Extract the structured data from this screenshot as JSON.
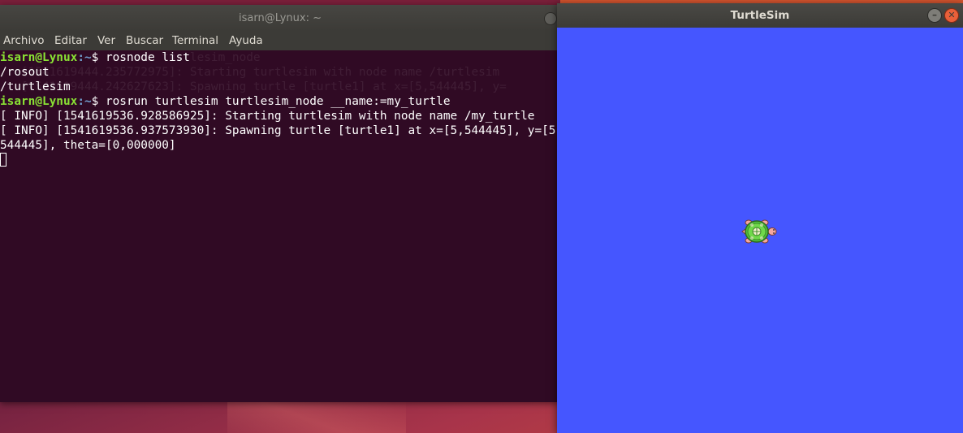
{
  "terminal": {
    "title": "isarn@Lynux: ~",
    "menu": [
      "Archivo",
      "Editar",
      "Ver",
      "Buscar",
      "Terminal",
      "Ayuda"
    ],
    "ghost_lines": [
      "                   sim turtlesim_node",
      "   [1541619444.235772975]: Starting turtlesim with node name /turtlesim",
      "   [1541619444.242627623]: Spawning turtle [turtle1] at x=[5,544445], y="
    ],
    "prompt_user": "isarn@Lynux",
    "prompt_path": ":~",
    "prompt_symbol": "$",
    "cmd1": " rosnode list",
    "out1": "/rosout",
    "out2": "/turtlesim",
    "cmd2": " rosrun turtlesim turtlesim_node __name:=my_turtle",
    "out3": "[ INFO] [1541619536.928586925]: Starting turtlesim with node name /my_turtle",
    "out4": "[ INFO] [1541619536.937573930]: Spawning turtle [turtle1] at x=[5,544445], y=[5,",
    "out5": "544445], theta=[0,000000]"
  },
  "turtlesim": {
    "title": "TurtleSim",
    "min_glyph": "–",
    "close_glyph": "✕",
    "background_color": "#4556ff"
  },
  "icons": {
    "turtle": "turtle-icon"
  }
}
